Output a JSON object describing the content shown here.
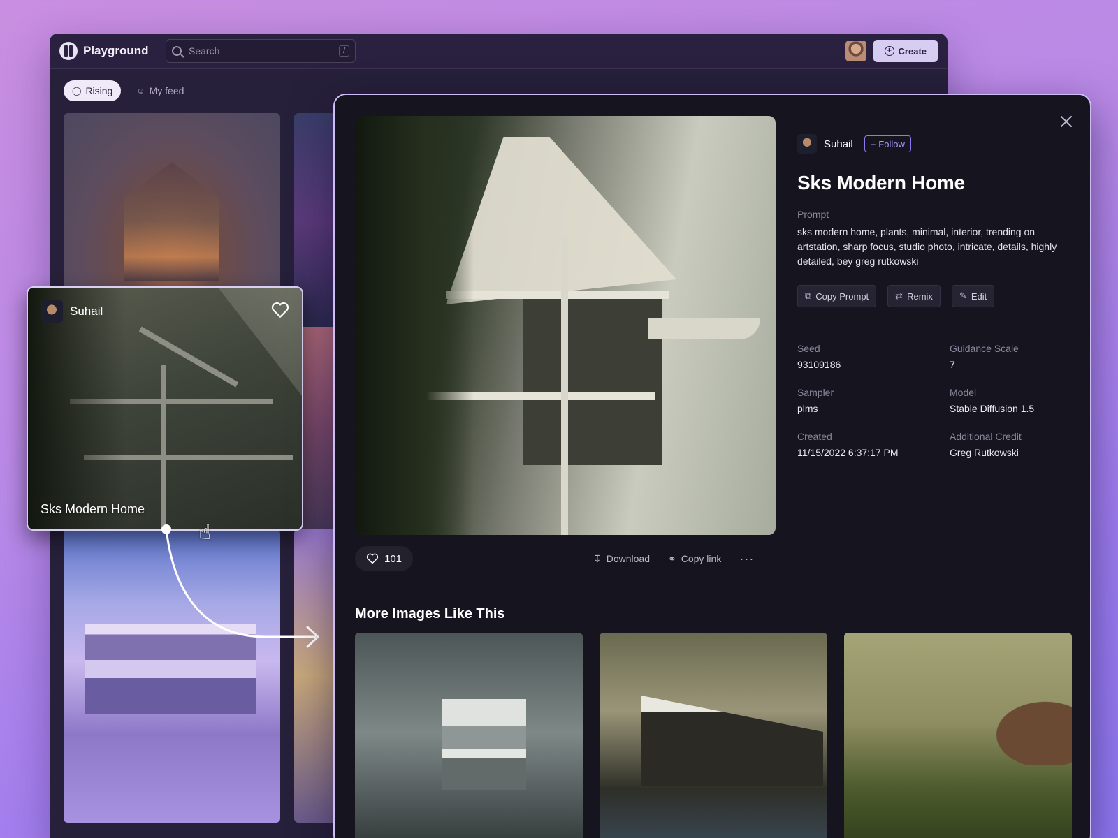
{
  "app": {
    "name": "Playground",
    "search": {
      "placeholder": "Search",
      "shortcut": "/"
    },
    "create_label": "Create",
    "filters": [
      {
        "label": "Rising",
        "icon": "flame-icon",
        "active": true
      },
      {
        "label": "My feed",
        "icon": "user-icon",
        "active": false
      }
    ]
  },
  "hover_card": {
    "author": "Suhail",
    "title": "Sks Modern Home"
  },
  "detail": {
    "author": "Suhail",
    "follow_label": "Follow",
    "title": "Sks Modern Home",
    "prompt_label": "Prompt",
    "prompt": "sks modern home, plants, minimal, interior, trending on artstation, sharp focus, studio photo, intricate, details, highly detailed, bey greg rutkowski",
    "tools": {
      "copy_prompt": "Copy Prompt",
      "remix": "Remix",
      "edit": "Edit"
    },
    "meta": {
      "seed_label": "Seed",
      "seed": "93109186",
      "guidance_label": "Guidance Scale",
      "guidance": "7",
      "sampler_label": "Sampler",
      "sampler": "plms",
      "model_label": "Model",
      "model": "Stable Diffusion 1.5",
      "created_label": "Created",
      "created": "11/15/2022 6:37:17 PM",
      "credit_label": "Additional Credit",
      "credit": "Greg Rutkowski"
    },
    "likes": "101",
    "download_label": "Download",
    "copy_link_label": "Copy link",
    "more_images_title": "More Images Like This"
  },
  "colors": {
    "background_start": "#c98ee0",
    "background_end": "#8e78f2",
    "accent": "#8a7cf0",
    "modal_bg": "#16141f"
  }
}
